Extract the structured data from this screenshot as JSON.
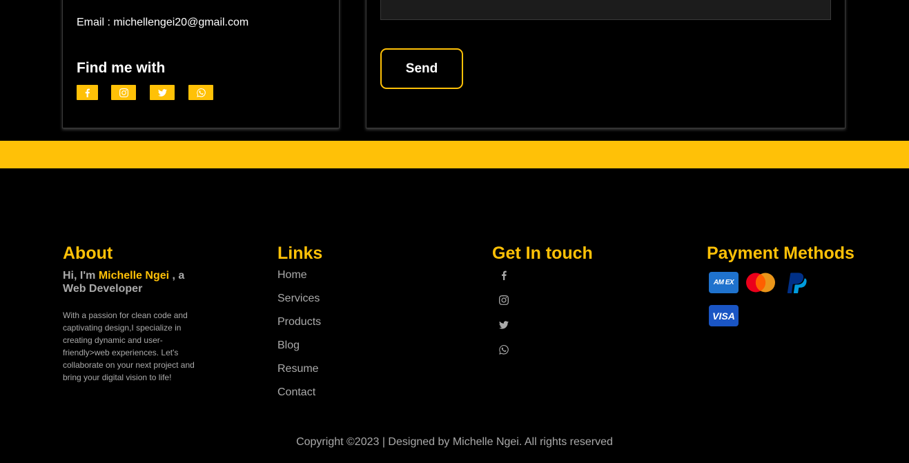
{
  "contact": {
    "email_line": "Email : michellengei20@gmail.com",
    "find_title": "Find me with",
    "social": [
      "facebook-icon",
      "instagram-icon",
      "twitter-icon",
      "whatsapp-icon"
    ],
    "send_label": "Send"
  },
  "footer": {
    "about": {
      "title": "About",
      "intro_prefix": "Hi, I'm ",
      "name": "Michelle Ngei",
      "intro_suffix": " , a Web Developer",
      "description": "With a passion for clean code and captivating design,I specialize in creating dynamic and user-friendly>web experiences. Let's collaborate on your next project and bring your digital vision to life!"
    },
    "links": {
      "title": "Links",
      "items": [
        "Home",
        "Services",
        "Products",
        "Blog",
        "Resume",
        "Contact"
      ]
    },
    "touch": {
      "title": "Get In touch",
      "icons": [
        "facebook-icon",
        "instagram-icon",
        "twitter-icon",
        "whatsapp-icon"
      ]
    },
    "payment": {
      "title": "Payment Methods",
      "amex_text": "AM EX",
      "visa_text": "VISA",
      "methods": [
        "amex-icon",
        "mastercard-icon",
        "paypal-icon",
        "visa-icon"
      ]
    },
    "copyright": "Copyright ©2023 | Designed by Michelle Ngei. All rights reserved"
  },
  "colors": {
    "accent": "#ffc107",
    "background": "#000000",
    "muted_text": "#aaaaaa"
  }
}
